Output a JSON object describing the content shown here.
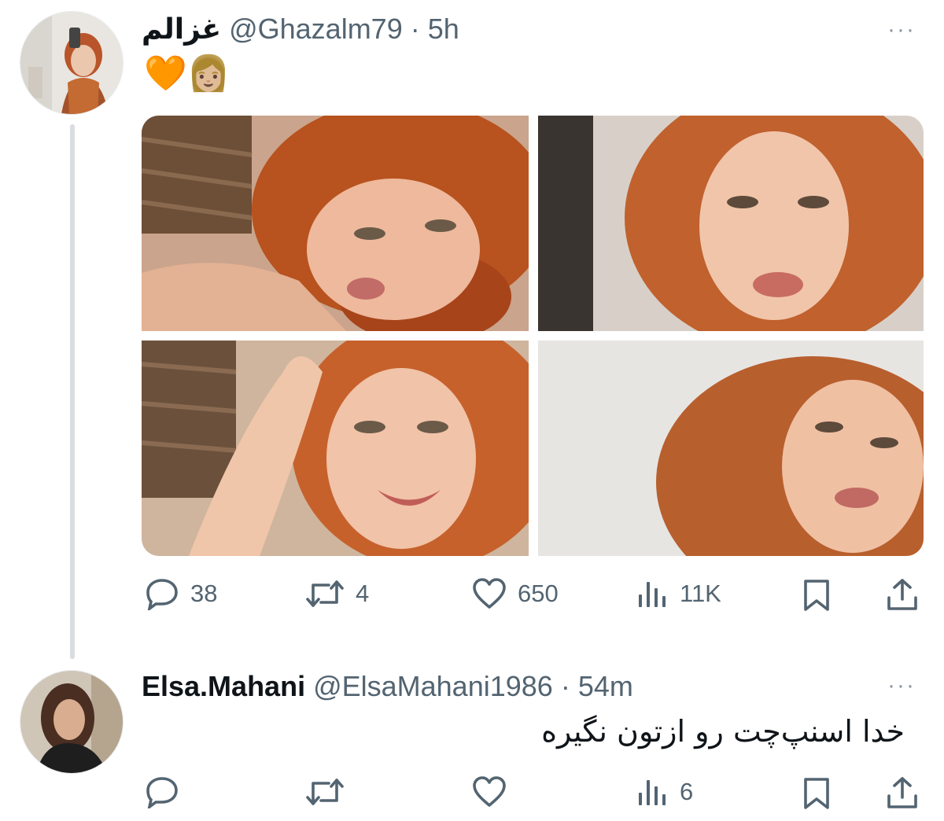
{
  "tweet": {
    "display_name": "غزالم",
    "handle": "@Ghazalm79",
    "time": "5h",
    "text": "🧡👩🏼",
    "counts": {
      "replies": "38",
      "retweets": "4",
      "likes": "650",
      "views": "11K"
    }
  },
  "reply": {
    "display_name": "Elsa.Mahani",
    "handle": "@ElsaMahani1986",
    "time": "54m",
    "text": "خدا اسنپ‌چت رو ازتون نگیره",
    "counts": {
      "views": "6"
    }
  },
  "separator": "·",
  "more_label": "···",
  "colors": {
    "icon": "#536471",
    "thread_line": "#d8dde1",
    "hair": "#c0531f"
  }
}
